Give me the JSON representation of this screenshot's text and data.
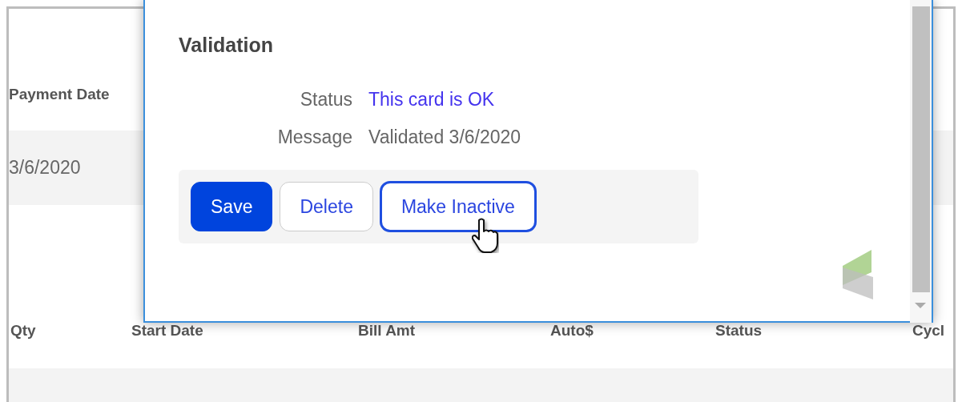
{
  "background_table_top": {
    "columns": [
      "Payment Date"
    ],
    "rows": [
      [
        "3/6/2020"
      ]
    ]
  },
  "background_table_bottom": {
    "columns": [
      "Qty",
      "Start Date",
      "Bill Amt",
      "Auto$",
      "Status",
      "Cycl"
    ]
  },
  "dialog": {
    "title": "Validation",
    "fields": [
      {
        "label": "Status",
        "value": "This card is OK",
        "kind": "link"
      },
      {
        "label": "Message",
        "value": "Validated 3/6/2020",
        "kind": "text"
      }
    ],
    "buttons": [
      {
        "label": "Save",
        "kind": "primary",
        "hovered": false
      },
      {
        "label": "Delete",
        "kind": "secondary",
        "hovered": false
      },
      {
        "label": "Make Inactive",
        "kind": "outline",
        "hovered": true
      }
    ]
  }
}
